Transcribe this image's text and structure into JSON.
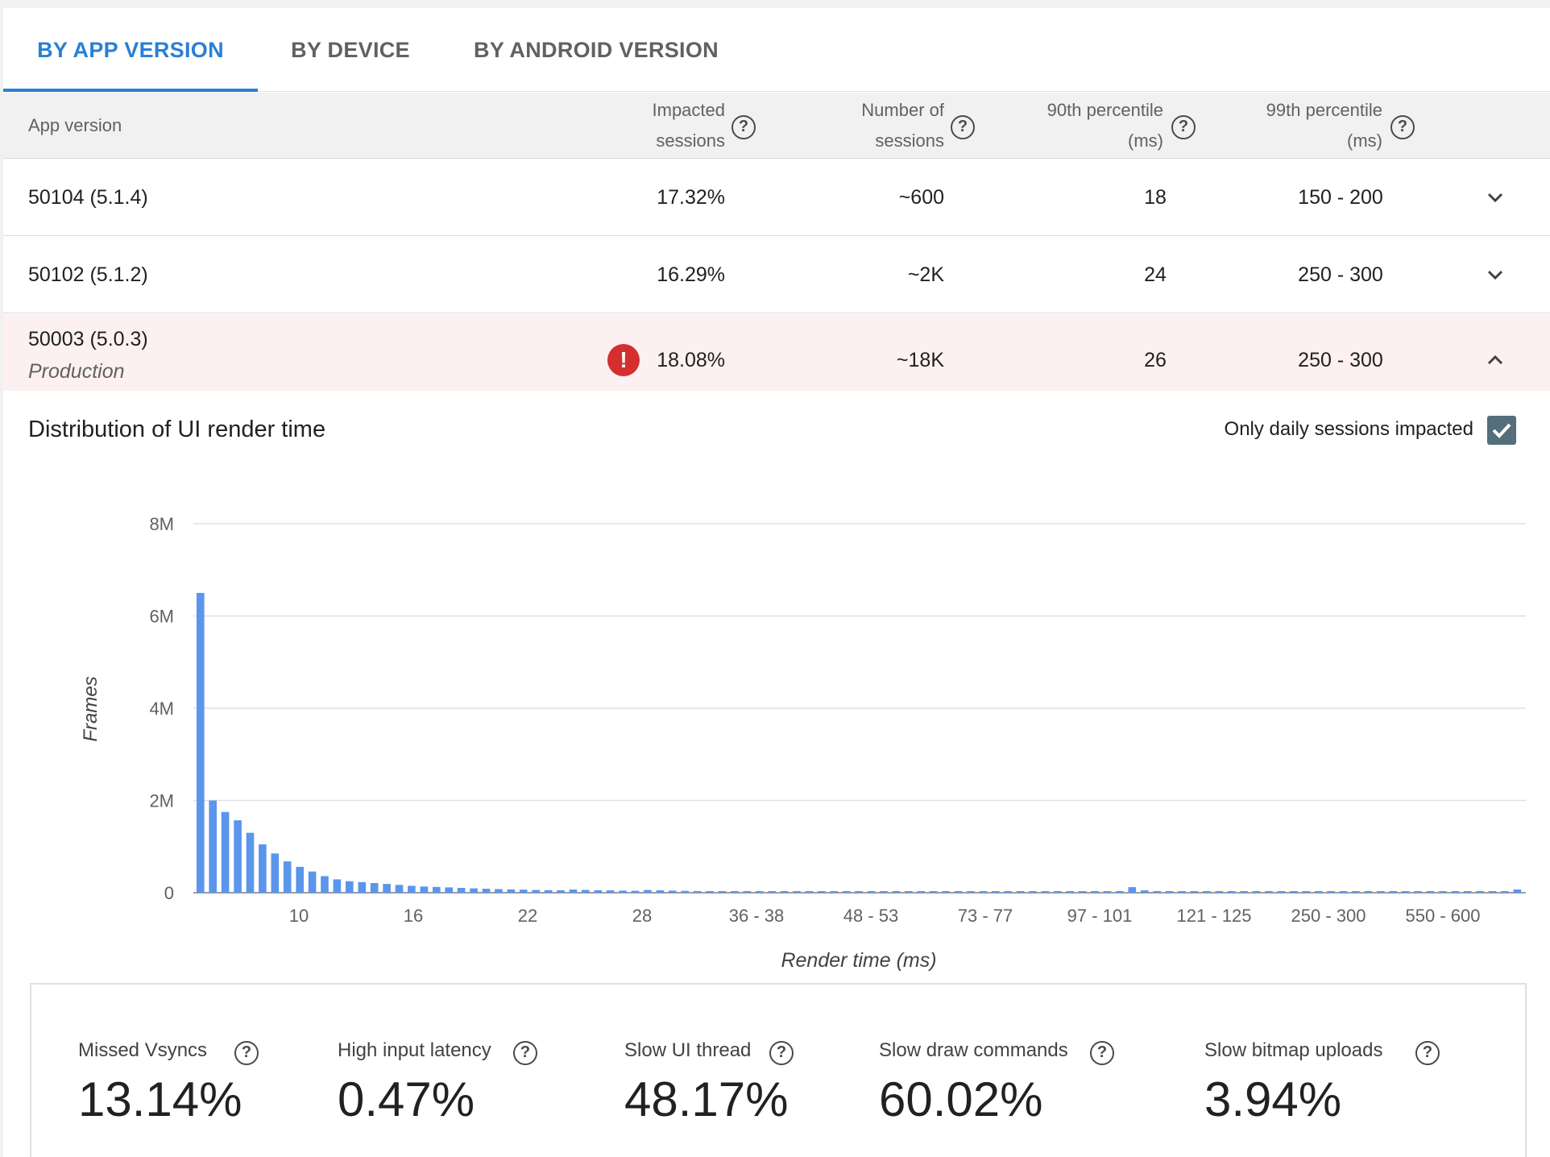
{
  "tabs": [
    {
      "label": "BY APP VERSION",
      "active": true
    },
    {
      "label": "BY DEVICE",
      "active": false
    },
    {
      "label": "BY ANDROID VERSION",
      "active": false
    }
  ],
  "table": {
    "headers": {
      "app_version": "App version",
      "impacted_1": "Impacted",
      "impacted_2": "sessions",
      "number_1": "Number of",
      "number_2": "sessions",
      "p90_1": "90th percentile",
      "p90_2": "(ms)",
      "p99_1": "99th percentile",
      "p99_2": "(ms)"
    },
    "rows": [
      {
        "version": "50104 (5.1.4)",
        "track": "",
        "impacted": "17.32%",
        "sessions": "~600",
        "p90": "18",
        "p99": "150 - 200",
        "expanded": false
      },
      {
        "version": "50102 (5.1.2)",
        "track": "",
        "impacted": "16.29%",
        "sessions": "~2K",
        "p90": "24",
        "p99": "250 - 300",
        "expanded": false
      },
      {
        "version": "50003 (5.0.3)",
        "track": "Production",
        "impacted": "18.08%",
        "sessions": "~18K",
        "p90": "26",
        "p99": "250 - 300",
        "expanded": true,
        "alert": true
      }
    ]
  },
  "chart_section": {
    "title": "Distribution of UI render time",
    "checkbox_label": "Only daily sessions impacted",
    "checkbox_checked": true
  },
  "chart_data": {
    "type": "bar",
    "xlabel": "Render time (ms)",
    "ylabel": "Frames",
    "ylim": [
      0,
      8000000
    ],
    "y_ticks": [
      "0",
      "2M",
      "4M",
      "6M",
      "8M"
    ],
    "x_tick_labels": [
      "10",
      "16",
      "22",
      "28",
      "36 - 38",
      "48 - 53",
      "73 - 77",
      "97 - 101",
      "121 - 125",
      "250 - 300",
      "550 - 600"
    ],
    "bar_color": "#5b95ec",
    "grid": true,
    "values": [
      6500000,
      2000000,
      1750000,
      1570000,
      1300000,
      1050000,
      850000,
      680000,
      560000,
      460000,
      360000,
      290000,
      250000,
      230000,
      210000,
      190000,
      170000,
      150000,
      135000,
      125000,
      115000,
      105000,
      95000,
      85000,
      78000,
      72000,
      66000,
      60000,
      56000,
      52000,
      70000,
      62000,
      55000,
      50000,
      46000,
      42000,
      60000,
      52000,
      45000,
      40000,
      36000,
      32000,
      28000,
      25000,
      22000,
      20000,
      18000,
      16000,
      14000,
      13000,
      12000,
      11000,
      10000,
      9000,
      8500,
      8000,
      7500,
      7000,
      6500,
      6000,
      5500,
      5000,
      4800,
      4600,
      4400,
      4200,
      4000,
      3800,
      3600,
      3400,
      3200,
      3000,
      2800,
      2600,
      2400,
      120000,
      50000,
      35000,
      25000,
      18000,
      14000,
      11000,
      9000,
      8000,
      7000,
      6000,
      5500,
      5000,
      4500,
      4000,
      3500,
      3200,
      3000,
      2800,
      2600,
      2400,
      2200,
      2000,
      1800,
      1600,
      1400,
      1200,
      1000,
      900,
      800,
      700,
      70000
    ]
  },
  "metrics": [
    {
      "label": "Missed Vsyncs",
      "value": "13.14%"
    },
    {
      "label": "High input latency",
      "value": "0.47%"
    },
    {
      "label": "Slow UI thread",
      "value": "48.17%"
    },
    {
      "label": "Slow draw commands",
      "value": "60.02%"
    },
    {
      "label": "Slow bitmap uploads",
      "value": "3.94%"
    }
  ]
}
